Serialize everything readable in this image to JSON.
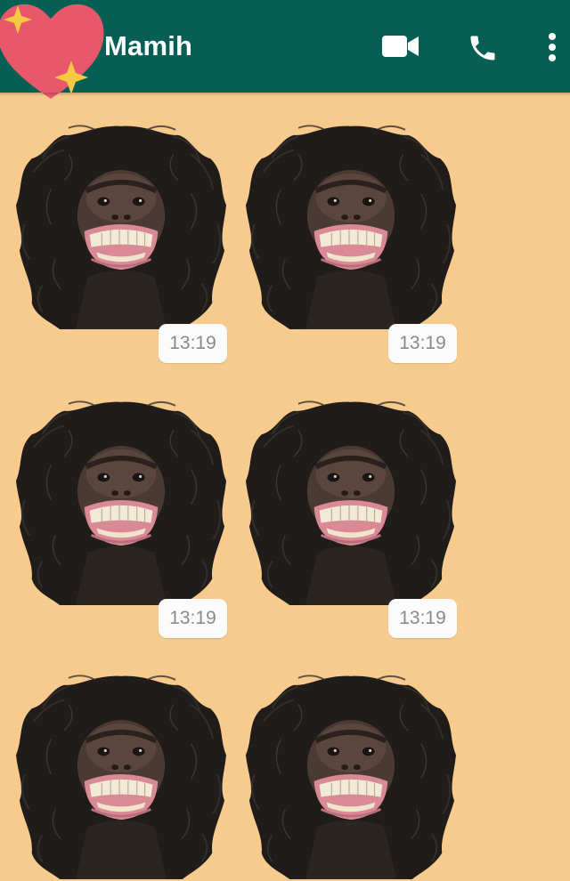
{
  "header": {
    "contact_name": "Mamih",
    "background_color": "#075e54",
    "avatar": "heart-with-sparkles-avatar",
    "icons": [
      "video-camera-icon",
      "phone-icon",
      "more-vertical-icon"
    ]
  },
  "chat": {
    "wallpaper_color": "#f6cb8d",
    "messages": [
      {
        "type": "sticker",
        "sticker": "laughing-chimp-sticker",
        "time": "13:19"
      },
      {
        "type": "sticker",
        "sticker": "laughing-chimp-sticker",
        "time": "13:19"
      },
      {
        "type": "sticker",
        "sticker": "laughing-chimp-sticker",
        "time": "13:19"
      },
      {
        "type": "sticker",
        "sticker": "laughing-chimp-sticker",
        "time": "13:19"
      },
      {
        "type": "sticker",
        "sticker": "laughing-chimp-sticker"
      },
      {
        "type": "sticker",
        "sticker": "laughing-chimp-sticker"
      }
    ]
  }
}
